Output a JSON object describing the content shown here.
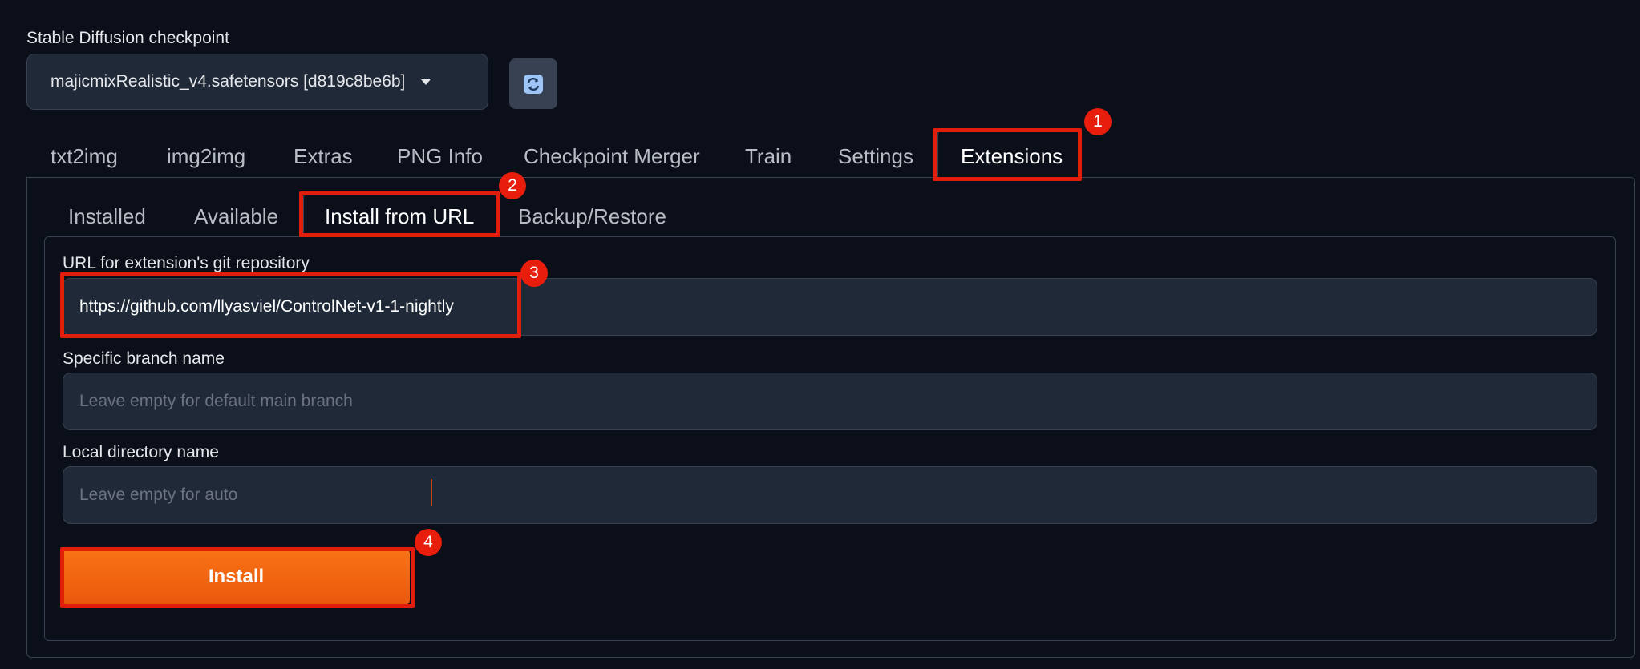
{
  "checkpoint": {
    "label": "Stable Diffusion checkpoint",
    "selected": "majicmixRealistic_v4.safetensors [d819c8be6b]",
    "refresh_icon": "refresh-icon"
  },
  "main_tabs": [
    {
      "label": "txt2img"
    },
    {
      "label": "img2img"
    },
    {
      "label": "Extras"
    },
    {
      "label": "PNG Info"
    },
    {
      "label": "Checkpoint Merger"
    },
    {
      "label": "Train"
    },
    {
      "label": "Settings"
    },
    {
      "label": "Extensions",
      "selected": true
    }
  ],
  "sub_tabs": [
    {
      "label": "Installed"
    },
    {
      "label": "Available"
    },
    {
      "label": "Install from URL",
      "selected": true
    },
    {
      "label": "Backup/Restore"
    }
  ],
  "form": {
    "url": {
      "label": "URL for extension's git repository",
      "value": "https://github.com/llyasviel/ControlNet-v1-1-nightly"
    },
    "branch": {
      "label": "Specific branch name",
      "placeholder": "Leave empty for default main branch"
    },
    "directory": {
      "label": "Local directory name",
      "placeholder": "Leave empty for auto"
    },
    "install_label": "Install"
  },
  "annotations": {
    "step1": "1",
    "step2": "2",
    "step3": "3",
    "step4": "4",
    "highlight_color": "#e11d0e"
  },
  "colors": {
    "background": "#0b0f19",
    "input_bg": "#1f2937",
    "accent": "#f97316"
  }
}
